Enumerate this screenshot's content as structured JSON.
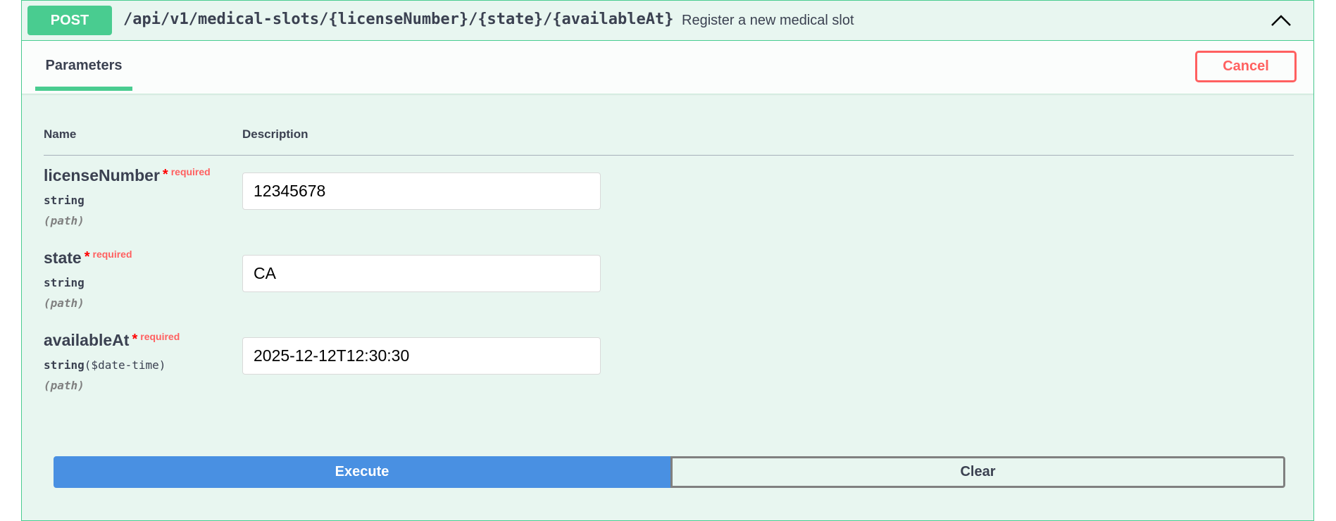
{
  "operation": {
    "method": "POST",
    "path": "/api/v1/medical-slots/{licenseNumber}/{state}/{availableAt}",
    "summary": "Register a new medical slot",
    "collapse_icon": "chevron-up-icon"
  },
  "section": {
    "tab_label": "Parameters",
    "cancel_label": "Cancel"
  },
  "table": {
    "name_header": "Name",
    "description_header": "Description"
  },
  "parameters": [
    {
      "name": "licenseNumber",
      "required_mark": "*",
      "required_label": "required",
      "type": "string",
      "format": "",
      "in": "(path)",
      "value": "12345678"
    },
    {
      "name": "state",
      "required_mark": "*",
      "required_label": "required",
      "type": "string",
      "format": "",
      "in": "(path)",
      "value": "CA"
    },
    {
      "name": "availableAt",
      "required_mark": "*",
      "required_label": "required",
      "type": "string",
      "format": "($date-time)",
      "in": "(path)",
      "value": "2025-12-12T12:30:30"
    }
  ],
  "actions": {
    "execute_label": "Execute",
    "clear_label": "Clear"
  },
  "colors": {
    "post_method": "#49cc90",
    "execute": "#4990e2",
    "cancel": "#ff6060",
    "required": "#ff0000"
  }
}
